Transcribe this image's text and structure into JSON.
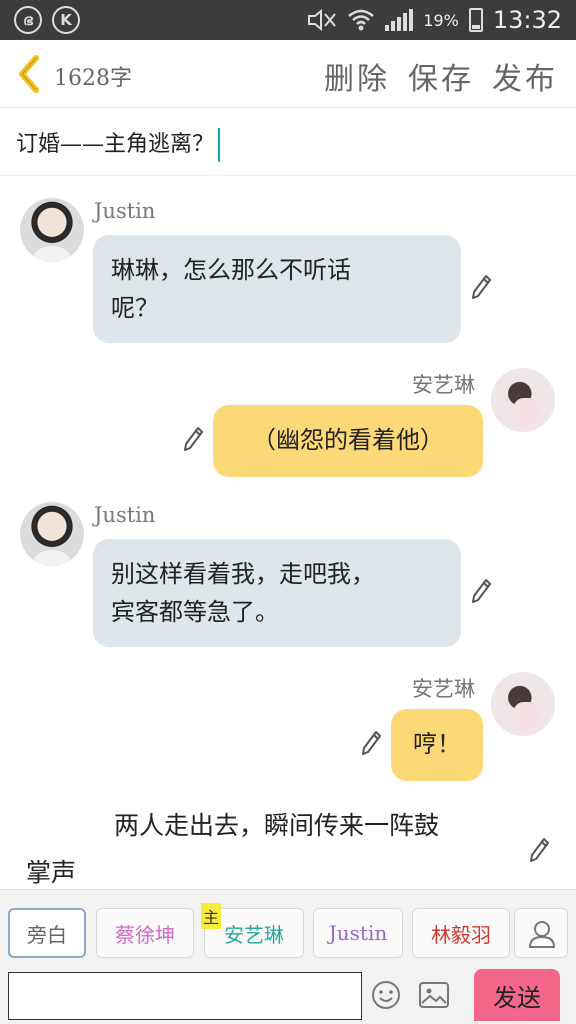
{
  "status_bar": {
    "left_icons": [
      "netease-icon",
      "k-icon"
    ],
    "battery_percent": "19%",
    "time": "13:32"
  },
  "header": {
    "word_count": "1628字",
    "actions": {
      "delete": "删除",
      "save": "保存",
      "publish": "发布"
    }
  },
  "story_title": "订婚——主角逃离？",
  "messages": [
    {
      "type": "left",
      "speaker": "Justin",
      "text_line1": "琳琳，怎么那么不听话",
      "text_line2": "呢？"
    },
    {
      "type": "right",
      "speaker": "安艺琳",
      "text": "（幽怨的看着他）"
    },
    {
      "type": "left",
      "speaker": "Justin",
      "text_line1": "别这样看着我，走吧我，",
      "text_line2": "宾客都等急了。"
    },
    {
      "type": "right",
      "speaker": "安艺琳",
      "text": "哼！"
    },
    {
      "type": "narration",
      "text_line1": "两人走出去，瞬间传来一阵鼓",
      "text_line2": "掌声"
    }
  ],
  "characters": [
    {
      "name": "旁白",
      "color": "#777777",
      "selected": true
    },
    {
      "name": "蔡徐坤",
      "color": "#d469c8"
    },
    {
      "name": "安艺琳",
      "color": "#2aa79a",
      "main_tag": "主"
    },
    {
      "name": "Justin",
      "color": "#9a66c8"
    },
    {
      "name": "林毅羽",
      "color": "#d03b2e"
    }
  ],
  "input": {
    "placeholder": "",
    "send_label": "发送"
  },
  "colors": {
    "left_bubble": "#dde6ea",
    "right_bubble": "#fcd976",
    "send_button": "#f4678a",
    "back_arrow": "#f2c31e"
  }
}
